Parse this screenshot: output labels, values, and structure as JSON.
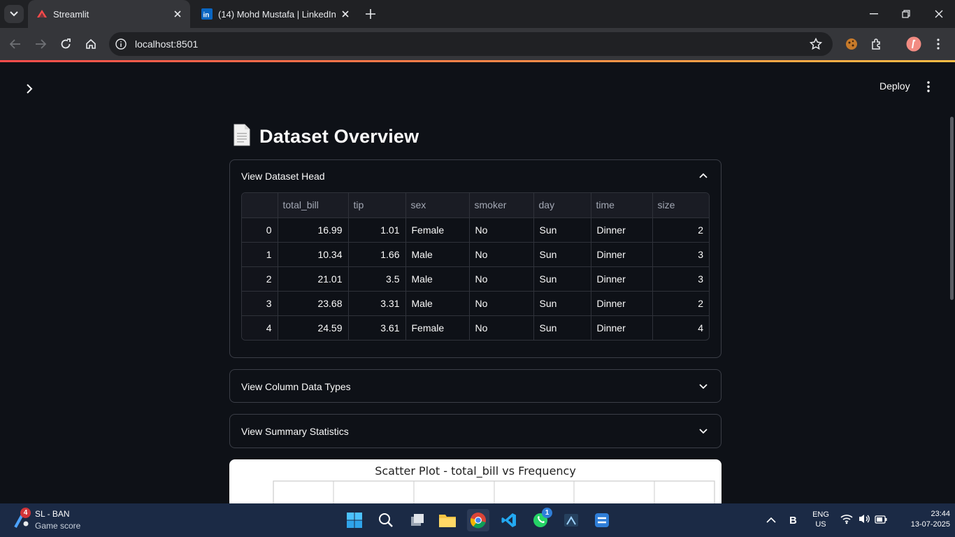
{
  "browser": {
    "tabs": [
      {
        "title": "Streamlit",
        "active": true,
        "favicon": "streamlit-icon"
      },
      {
        "title": "(14) Mohd Mustafa | LinkedIn",
        "active": false,
        "favicon": "linkedin-icon"
      }
    ],
    "url": "localhost:8501"
  },
  "app": {
    "deploy_label": "Deploy",
    "title_emoji": "page-icon",
    "title": "Dataset Overview",
    "expanders": [
      {
        "label": "View Dataset Head",
        "expanded": true
      },
      {
        "label": "View Column Data Types",
        "expanded": false
      },
      {
        "label": "View Summary Statistics",
        "expanded": false
      }
    ],
    "table": {
      "columns": [
        "",
        "total_bill",
        "tip",
        "sex",
        "smoker",
        "day",
        "time",
        "size"
      ],
      "rows": [
        [
          "0",
          "16.99",
          "1.01",
          "Female",
          "No",
          "Sun",
          "Dinner",
          "2"
        ],
        [
          "1",
          "10.34",
          "1.66",
          "Male",
          "No",
          "Sun",
          "Dinner",
          "3"
        ],
        [
          "2",
          "21.01",
          "3.5",
          "Male",
          "No",
          "Sun",
          "Dinner",
          "3"
        ],
        [
          "3",
          "23.68",
          "3.31",
          "Male",
          "No",
          "Sun",
          "Dinner",
          "2"
        ],
        [
          "4",
          "24.59",
          "3.61",
          "Female",
          "No",
          "Sun",
          "Dinner",
          "4"
        ]
      ]
    },
    "chart_title": "Scatter Plot - total_bill vs Frequency"
  },
  "taskbar": {
    "widget": {
      "badge": "4",
      "title": "SL - BAN",
      "subtitle": "Game score"
    },
    "whatsapp_badge": "1",
    "lang": {
      "line1": "ENG",
      "line2": "US"
    },
    "clock": {
      "time": "23:44",
      "date": "13-07-2025"
    }
  },
  "colors": {
    "app_bg": "#0e1117",
    "accent": "#ff4b4b",
    "taskbar": "#1b2a45"
  }
}
